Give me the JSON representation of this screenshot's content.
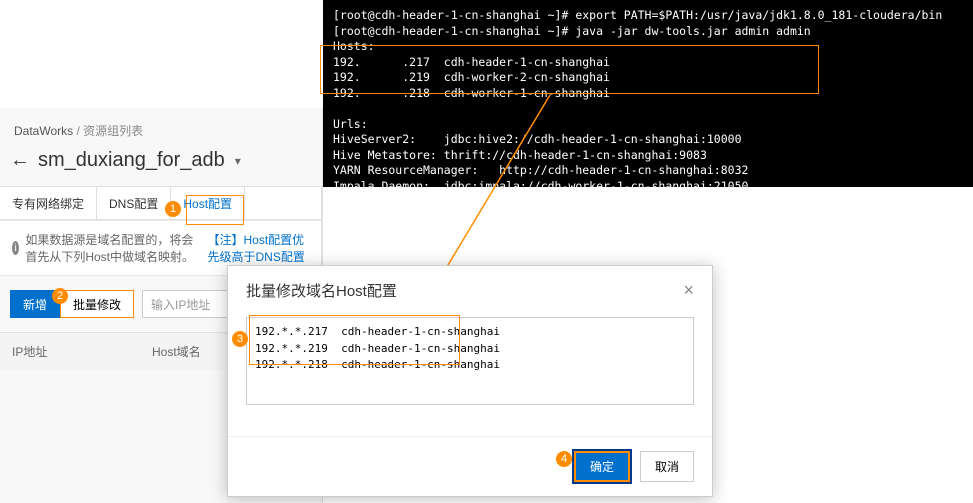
{
  "terminal": {
    "line1": "[root@cdh-header-1-cn-shanghai ~]# export PATH=$PATH:/usr/java/jdk1.8.0_181-cloudera/bin",
    "line2": "[root@cdh-header-1-cn-shanghai ~]# java -jar dw-tools.jar admin admin",
    "line3": "Hosts:",
    "host1": "192.      .217  cdh-header-1-cn-shanghai",
    "host2": "192.      .219  cdh-worker-2-cn-shanghai",
    "host3": "192.      .218  cdh-worker-1-cn-shanghai",
    "blank": "",
    "urls": "Urls:",
    "u1": "HiveServer2:    jdbc:hive2://cdh-header-1-cn-shanghai:10000",
    "u2": "Hive Metastore: thrift://cdh-header-1-cn-shanghai:9083",
    "u3": "YARN ResourceManager:   http://cdh-header-1-cn-shanghai:8032",
    "u4": "Impala Daemon:  jdbc:impala://cdh-worker-1-cn-shanghai:21050"
  },
  "breadcrumb": {
    "app": "DataWorks",
    "sep": "/",
    "page": "资源组列表"
  },
  "page_title": "sm_duxiang_for_adb",
  "tabs": {
    "t1": "专有网络绑定",
    "t2": "DNS配置",
    "t3": "Host配置"
  },
  "info": {
    "text": "如果数据源是域名配置的，将会首先从下列Host中做域名映射。",
    "note": "【注】Host配置优先级高于DNS配置"
  },
  "actions": {
    "add": "新增",
    "batch": "批量修改",
    "ip_placeholder": "输入IP地址"
  },
  "table": {
    "col1": "IP地址",
    "col2": "Host域名"
  },
  "dialog": {
    "title": "批量修改域名Host配置",
    "content": "192.*.*.217  cdh-header-1-cn-shanghai\n192.*.*.219  cdh-header-1-cn-shanghai\n192.*.*.218  cdh-header-1-cn-shanghai",
    "confirm": "确定",
    "cancel": "取消"
  },
  "badges": {
    "b1": "1",
    "b2": "2",
    "b3": "3",
    "b4": "4"
  }
}
